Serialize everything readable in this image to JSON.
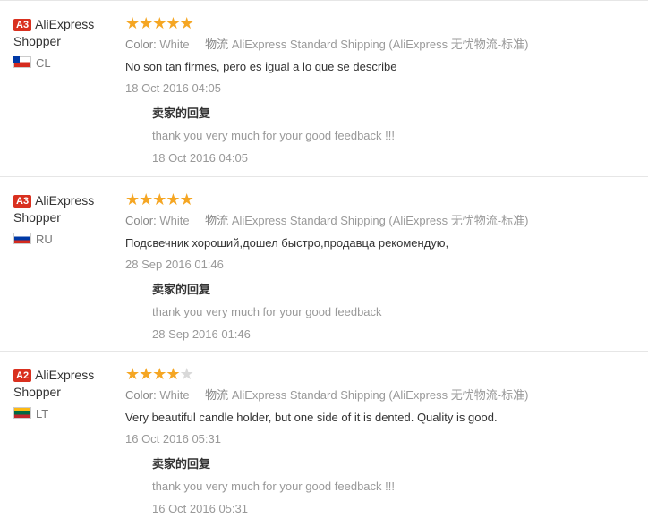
{
  "reviews": [
    {
      "level": "A3",
      "user_name": "AliExpress Shopper",
      "country": "CL",
      "rating": 5,
      "color_label": "Color:",
      "color_value": "White",
      "shipping_label": "物流",
      "shipping_value": "AliExpress Standard Shipping (AliExpress 无忧物流-标准)",
      "text": "No son tan firmes, pero es igual a lo que se describe",
      "date": "18 Oct 2016 04:05",
      "reply_title": "卖家的回复",
      "reply_text": "thank you very much for your good feedback !!!",
      "reply_date": "18 Oct 2016 04:05"
    },
    {
      "level": "A3",
      "user_name": "AliExpress Shopper",
      "country": "RU",
      "rating": 5,
      "color_label": "Color:",
      "color_value": "White",
      "shipping_label": "物流",
      "shipping_value": "AliExpress Standard Shipping (AliExpress 无忧物流-标准)",
      "text": "Подсвечник хороший,дошел быстро,продавца рекомендую,",
      "date": "28 Sep 2016 01:46",
      "reply_title": "卖家的回复",
      "reply_text": "thank you very much for your good feedback",
      "reply_date": "28 Sep 2016 01:46"
    },
    {
      "level": "A2",
      "user_name": "AliExpress Shopper",
      "country": "LT",
      "rating": 4,
      "color_label": "Color:",
      "color_value": "White",
      "shipping_label": "物流",
      "shipping_value": "AliExpress Standard Shipping (AliExpress 无忧物流-标准)",
      "text": "Very beautiful candle holder, but one side of it is dented. Quality is good.",
      "date": "16 Oct 2016 05:31",
      "reply_title": "卖家的回复",
      "reply_text": "thank you very much for your good feedback !!!",
      "reply_date": "16 Oct 2016 05:31"
    }
  ],
  "colors": {
    "badge": "#d9301f",
    "star": "#f5a623",
    "star_empty": "#d9d9d9",
    "muted": "#999999"
  },
  "icons": {
    "star": "star-icon",
    "flag": "flag-icon"
  }
}
